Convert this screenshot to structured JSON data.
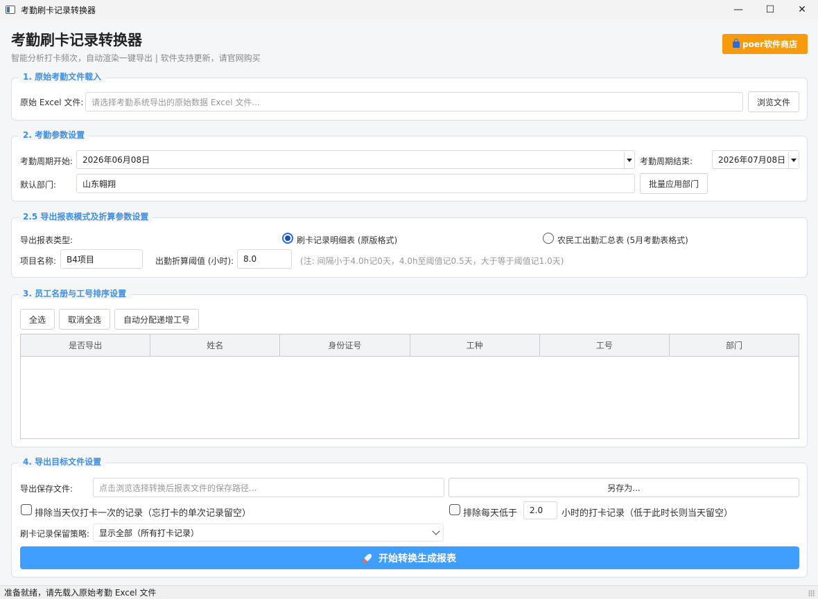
{
  "window": {
    "title": "考勤刷卡记录转换器",
    "minimize": "—",
    "maximize": "☐",
    "close": "✕"
  },
  "header": {
    "title": "考勤刷卡记录转换器",
    "subtitle": "智能分析打卡频次，自动渲染一键导出 | 软件支持更新，请官网购买",
    "shop_label": "poer软件商店"
  },
  "section1": {
    "title": "1. 原始考勤文件载入",
    "file_label": "原始 Excel 文件:",
    "file_placeholder": "请选择考勤系统导出的原始数据 Excel 文件...",
    "browse_label": "浏览文件"
  },
  "section2": {
    "title": "2. 考勤参数设置",
    "start_label": "考勤周期开始:",
    "start_value": "2026年06月08日",
    "end_label": "考勤周期结束:",
    "end_value": "2026年07月08日",
    "dept_label": "默认部门:",
    "dept_value": "山东翱翔",
    "apply_label": "批量应用部门"
  },
  "section25": {
    "title": "2.5 导出报表模式及折算参数设置",
    "type_label": "导出报表类型:",
    "option1": "刷卡记录明细表 (原版格式)",
    "option2": "农民工出勤汇总表 (5月考勤表格式)",
    "project_label": "项目名称:",
    "project_value": "B4项目",
    "threshold_label": "出勤折算阈值 (小时):",
    "threshold_value": "8.0",
    "note": "(注: 间隔小于4.0h记0天，4.0h至阈值记0.5天，大于等于阈值记1.0天)"
  },
  "section3": {
    "title": "3. 员工名册与工号排序设置",
    "select_all": "全选",
    "deselect_all": "取消全选",
    "auto_assign": "自动分配递增工号",
    "columns": [
      "是否导出",
      "姓名",
      "身份证号",
      "工种",
      "工号",
      "部门"
    ]
  },
  "section4": {
    "title": "4. 导出目标文件设置",
    "save_label": "导出保存文件:",
    "save_placeholder": "点击浏览选择转换后报表文件的保存路径...",
    "save_as": "另存为...",
    "exclude_single": "排除当天仅打卡一次的记录（忘打卡的单次记录留空）",
    "exclude_low_prefix": "排除每天低于",
    "exclude_low_value": "2.0",
    "exclude_low_suffix": "小时的打卡记录（低于此时长则当天留空）",
    "policy_label": "刷卡记录保留策略:",
    "policy_value": "显示全部（所有打卡记录）",
    "start_button": "开始转换生成报表"
  },
  "status": {
    "text": "准备就绪，请先载入原始考勤 Excel 文件"
  }
}
